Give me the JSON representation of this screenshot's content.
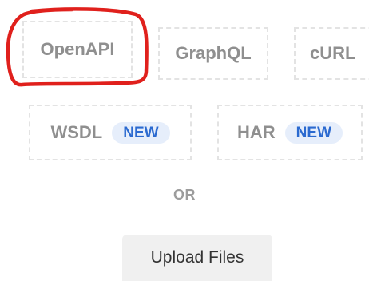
{
  "import_options": {
    "openapi": {
      "label": "OpenAPI"
    },
    "graphql": {
      "label": "GraphQL"
    },
    "curl": {
      "label": "cURL"
    },
    "wsdl": {
      "label": "WSDL",
      "badge": "NEW"
    },
    "har": {
      "label": "HAR",
      "badge": "NEW"
    }
  },
  "divider_text": "OR",
  "upload_button_label": "Upload Files",
  "colors": {
    "tile_border": "#e3e3e3",
    "tile_text": "#8f8f8f",
    "badge_bg": "#e6eefb",
    "badge_text": "#2b6ad0",
    "upload_bg": "#f0f0f0",
    "annotation_red": "#e0201c"
  }
}
